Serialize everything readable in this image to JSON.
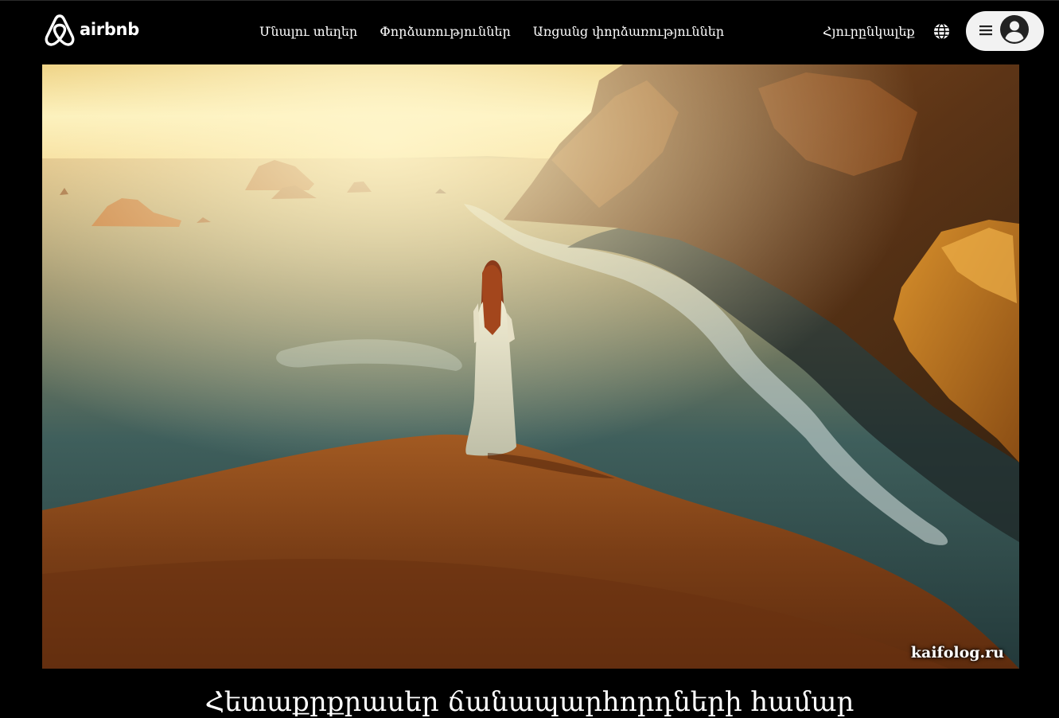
{
  "brand": {
    "name": "airbnb",
    "icon": "airbnb-logo-icon",
    "color": "#ffffff"
  },
  "nav": {
    "items": [
      {
        "label": "Մնալու տեղեր"
      },
      {
        "label": "Փորձառություններ"
      },
      {
        "label": "Առցանց փորձառություններ"
      }
    ]
  },
  "header": {
    "host_label": "Հյուրընկալեք",
    "language_icon": "globe-icon",
    "menu_icon": "hamburger-icon",
    "avatar_icon": "user-avatar-icon"
  },
  "hero": {
    "watermark": "kaifolog.ru",
    "image_subject": "woman in white dress standing on a cliff above the sea at sunset"
  },
  "headline": {
    "text": "Հետաքրքրասեր ճանապարհորդների համար"
  },
  "colors": {
    "background": "#000000",
    "text": "#ffffff",
    "menu_pill": "#f2f2f2",
    "avatar": "#222222"
  }
}
